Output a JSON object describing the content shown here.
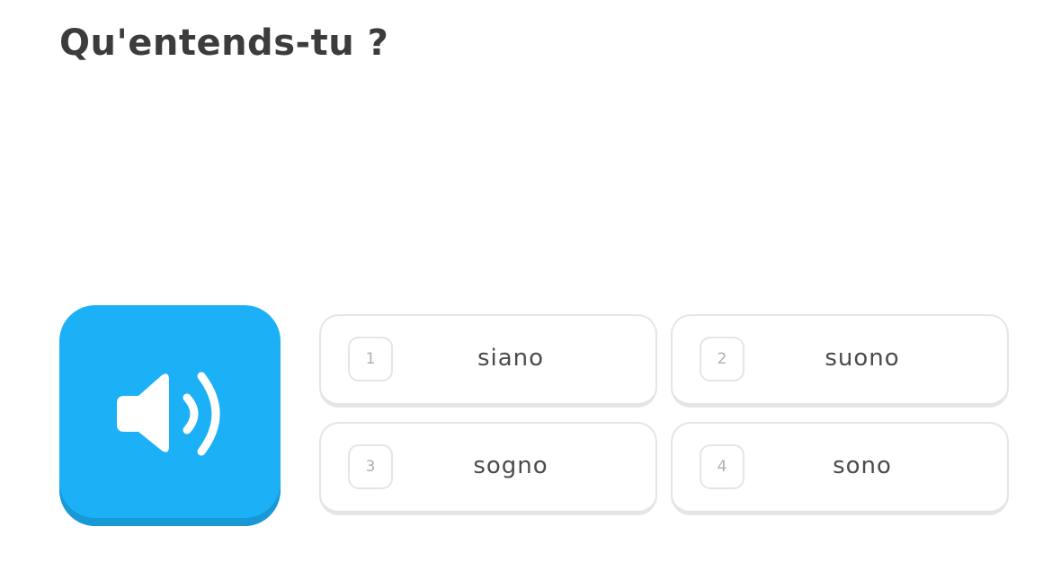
{
  "prompt": {
    "title": "Qu'entends-tu ?"
  },
  "audio_button": {
    "icon": "speaker-icon",
    "color": "#1cb0f6"
  },
  "choices": [
    {
      "number": "1",
      "text": "siano"
    },
    {
      "number": "2",
      "text": "suono"
    },
    {
      "number": "3",
      "text": "sogno"
    },
    {
      "number": "4",
      "text": "sono"
    }
  ]
}
